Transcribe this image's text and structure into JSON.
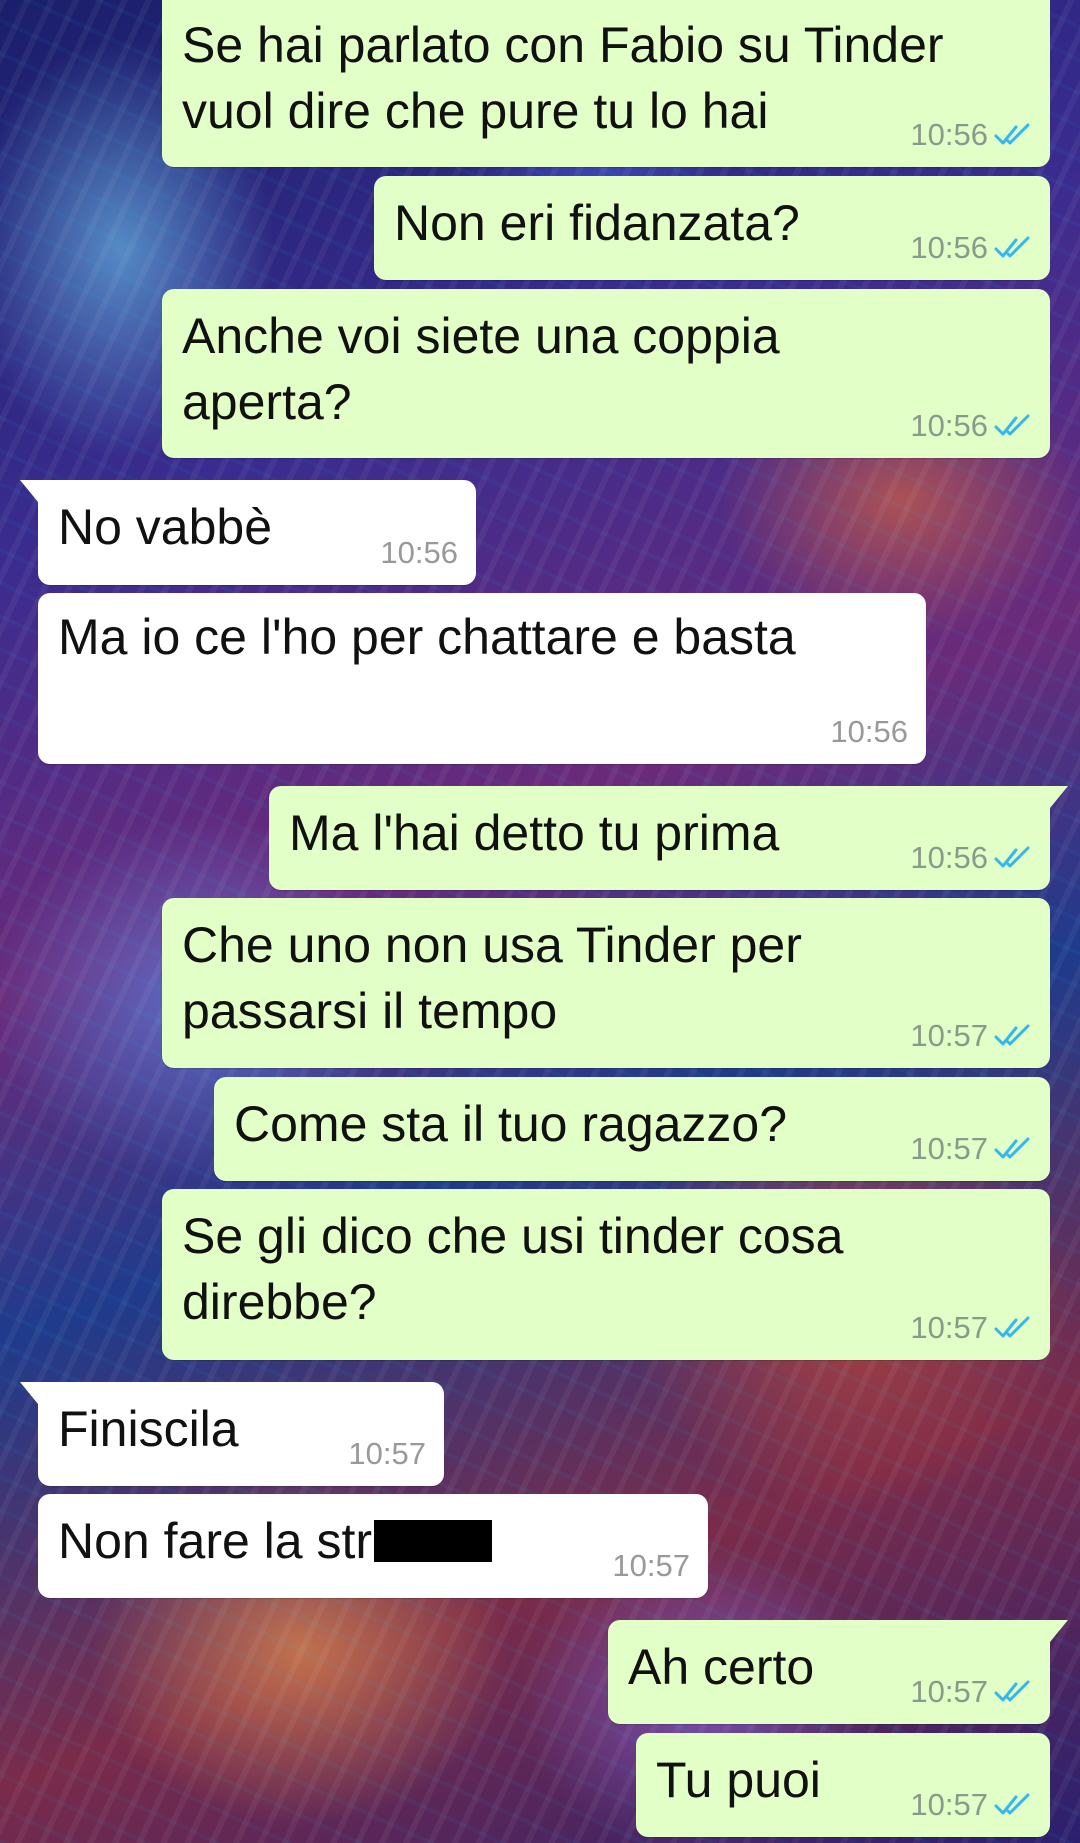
{
  "messages": [
    {
      "dir": "out",
      "text": "Se hai parlato con Fabio su Tinder\nvuol dire che pure tu lo hai",
      "time": "10:56",
      "status": "read"
    },
    {
      "dir": "out",
      "text": "Non eri fidanzata?",
      "time": "10:56",
      "status": "read"
    },
    {
      "dir": "out",
      "text": "Anche voi siete una coppia\naperta?",
      "time": "10:56",
      "status": "read"
    },
    {
      "dir": "in",
      "text": "No vabbè",
      "time": "10:56"
    },
    {
      "dir": "in",
      "text": "Ma io ce l'ho per chattare e basta",
      "time": "10:56"
    },
    {
      "dir": "out",
      "text": "Ma l'hai detto tu prima",
      "time": "10:56",
      "status": "read"
    },
    {
      "dir": "out",
      "text": "Che uno non usa Tinder per\npassarsi il tempo",
      "time": "10:57",
      "status": "read"
    },
    {
      "dir": "out",
      "text": "Come sta il tuo ragazzo?",
      "time": "10:57",
      "status": "read"
    },
    {
      "dir": "out",
      "text": "Se gli dico che usi tinder cosa\ndirebbe?",
      "time": "10:57",
      "status": "read"
    },
    {
      "dir": "in",
      "text": "Finiscila",
      "time": "10:57"
    },
    {
      "dir": "in",
      "text": "Non fare la str",
      "time": "10:57",
      "redacted": true
    },
    {
      "dir": "out",
      "text": "Ah certo",
      "time": "10:57",
      "status": "read"
    },
    {
      "dir": "out",
      "text": "Tu puoi",
      "time": "10:57",
      "status": "read"
    }
  ],
  "colors": {
    "outgoing_bubble": "#e1ffc7",
    "incoming_bubble": "#ffffff",
    "read_ticks": "#34b7f1"
  },
  "icons": {
    "read_receipt": "double-check-icon"
  }
}
